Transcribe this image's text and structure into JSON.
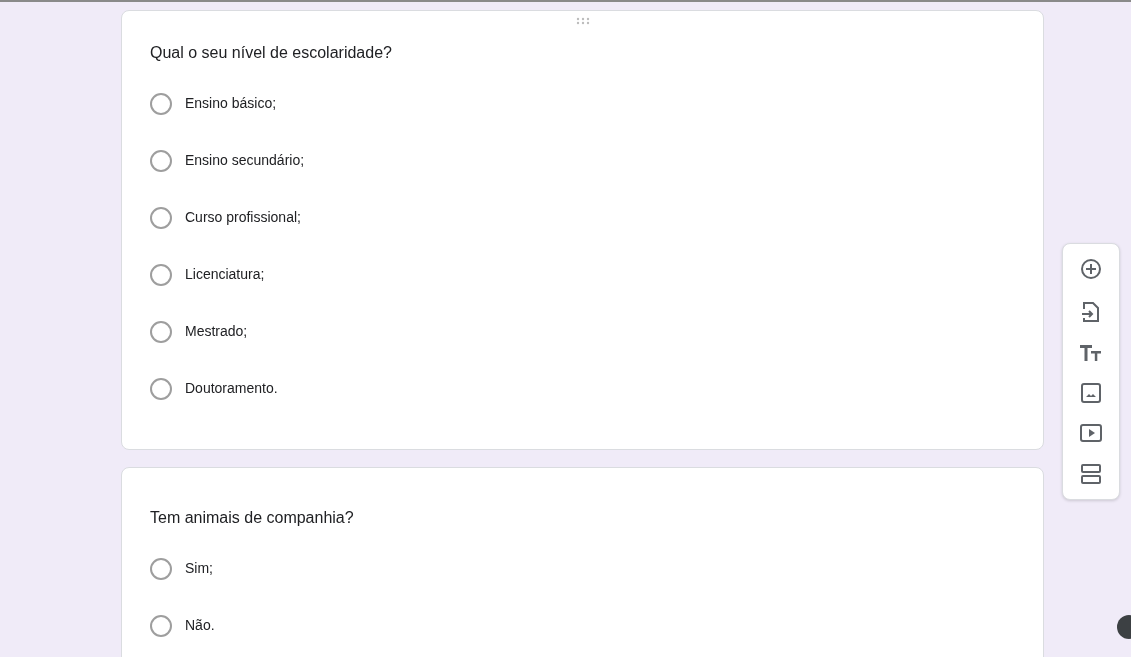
{
  "questions": [
    {
      "title": "Qual o seu nível de escolaridade?",
      "options": [
        {
          "label": "Ensino básico;",
          "selected": false
        },
        {
          "label": "Ensino secundário;",
          "selected": false
        },
        {
          "label": "Curso profissional;",
          "selected": false
        },
        {
          "label": "Licenciatura;",
          "selected": false
        },
        {
          "label": "Mestrado;",
          "selected": false
        },
        {
          "label": "Doutoramento.",
          "selected": false
        }
      ]
    },
    {
      "title": "Tem animais de companhia?",
      "options": [
        {
          "label": "Sim;",
          "selected": false
        },
        {
          "label": "Não.",
          "selected": false
        }
      ]
    }
  ]
}
